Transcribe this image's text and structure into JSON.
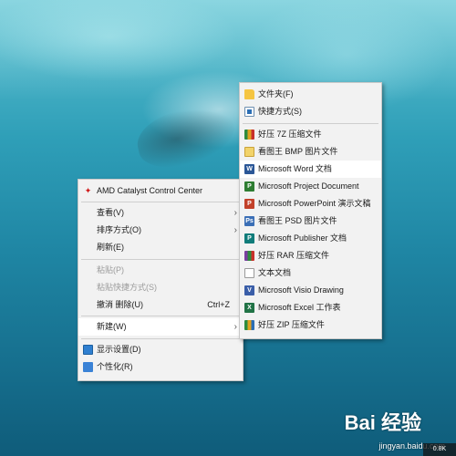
{
  "context_menu": {
    "items": [
      {
        "label": "AMD Catalyst Control Center",
        "icon": "amd-icon"
      },
      {
        "label": "查看(V)",
        "submenu": true
      },
      {
        "label": "排序方式(O)",
        "submenu": true
      },
      {
        "label": "刷新(E)"
      },
      {
        "label": "粘贴(P)",
        "disabled": true
      },
      {
        "label": "粘贴快捷方式(S)",
        "disabled": true
      },
      {
        "label": "撤消 删除(U)",
        "shortcut": "Ctrl+Z"
      },
      {
        "label": "新建(W)",
        "submenu": true,
        "highlighted": true
      },
      {
        "label": "显示设置(D)",
        "icon": "display-settings-icon"
      },
      {
        "label": "个性化(R)",
        "icon": "personalize-icon"
      }
    ],
    "arrow_glyph": "›"
  },
  "new_submenu": {
    "items": [
      {
        "label": "文件夹(F)",
        "icon": "folder-icon"
      },
      {
        "label": "快捷方式(S)",
        "icon": "shortcut-icon"
      },
      {
        "label": "好压 7Z 压缩文件",
        "icon": "7z-archive-icon"
      },
      {
        "label": "看图王 BMP 图片文件",
        "icon": "bmp-image-icon"
      },
      {
        "label": "Microsoft Word 文档",
        "icon": "word-icon",
        "highlighted": true
      },
      {
        "label": "Microsoft Project Document",
        "icon": "project-icon"
      },
      {
        "label": "Microsoft PowerPoint 演示文稿",
        "icon": "powerpoint-icon"
      },
      {
        "label": "看图王 PSD 图片文件",
        "icon": "psd-image-icon"
      },
      {
        "label": "Microsoft Publisher 文档",
        "icon": "publisher-icon"
      },
      {
        "label": "好压 RAR 压缩文件",
        "icon": "rar-archive-icon"
      },
      {
        "label": "文本文档",
        "icon": "text-document-icon"
      },
      {
        "label": "Microsoft Visio Drawing",
        "icon": "visio-icon"
      },
      {
        "label": "Microsoft Excel 工作表",
        "icon": "excel-icon"
      },
      {
        "label": "好压 ZIP 压缩文件",
        "icon": "zip-archive-icon"
      }
    ]
  },
  "watermark": {
    "brand": "Bai 经验",
    "url": "jingyan.baidu.com",
    "badge": "0.8K"
  },
  "colors": {
    "menu_bg": "#f2f2f2",
    "highlight_bg": "#ffffff",
    "disabled_text": "#9b9b9b",
    "water": "#1f86a4"
  }
}
